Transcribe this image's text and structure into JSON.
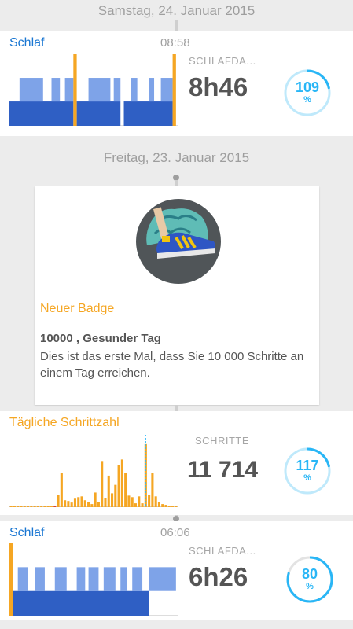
{
  "day1": {
    "date": "Samstag, 24. Januar 2015",
    "sleep": {
      "title": "Schlaf",
      "time": "08:58",
      "label": "SCHLAFDA...",
      "value": "8h46",
      "percent": "109",
      "percent_unit": "%",
      "percent_value": 109
    }
  },
  "day2": {
    "date": "Freitag, 23. Januar 2015",
    "badge": {
      "title": "Neuer Badge",
      "name": "10000 , Gesunder Tag",
      "description": "Dies ist das erste Mal, dass Sie 10 000 Schritte an einem Tag erreichen."
    },
    "steps": {
      "title": "Tägliche Schrittzahl",
      "label": "SCHRITTE",
      "value": "11 714",
      "percent": "117",
      "percent_unit": "%",
      "percent_value": 117
    },
    "sleep": {
      "title": "Schlaf",
      "time": "06:06",
      "label": "SCHLAFDA...",
      "value": "6h26",
      "percent": "80",
      "percent_unit": "%",
      "percent_value": 80
    }
  },
  "colors": {
    "sleep_title": "#1976d2",
    "steps_title": "#f5a623",
    "light_sleep": "#7ea3e8",
    "deep_sleep": "#2f5fc4",
    "awake": "#f5a623",
    "ring": "#29b6f6",
    "ring_track": "#e3e3e3"
  },
  "chart_data": [
    {
      "type": "bar",
      "title": "Schlaf",
      "note_segments": "sleep phase timeline, bands: light, deep, awake",
      "series": [
        {
          "phase": "deep",
          "spans": [
            [
              0,
              0.38
            ],
            [
              0.4,
              0.66
            ],
            [
              0.68,
              0.97
            ]
          ]
        },
        {
          "phase": "light",
          "spans": [
            [
              0.06,
              0.2
            ],
            [
              0.25,
              0.3
            ],
            [
              0.33,
              0.38
            ],
            [
              0.47,
              0.6
            ],
            [
              0.62,
              0.66
            ],
            [
              0.72,
              0.76
            ],
            [
              0.83,
              0.86
            ],
            [
              0.9,
              0.97
            ]
          ]
        },
        {
          "phase": "awake",
          "spans": [
            [
              0.38,
              0.4
            ],
            [
              0.97,
              0.99
            ]
          ]
        }
      ]
    },
    {
      "type": "bar",
      "title": "Tägliche Schrittzahl",
      "values": [
        2,
        2,
        2,
        2,
        2,
        2,
        2,
        2,
        2,
        2,
        2,
        2,
        2,
        2,
        16,
        45,
        9,
        8,
        6,
        11,
        13,
        14,
        9,
        7,
        4,
        19,
        7,
        60,
        12,
        41,
        18,
        29,
        55,
        62,
        45,
        15,
        13,
        5,
        14,
        5,
        82,
        16,
        45,
        14,
        7,
        4,
        3,
        2,
        2,
        2
      ]
    },
    {
      "type": "bar",
      "title": "Schlaf",
      "series": [
        {
          "phase": "deep",
          "spans": [
            [
              0.02,
              0.83
            ]
          ]
        },
        {
          "phase": "light",
          "spans": [
            [
              0.05,
              0.11
            ],
            [
              0.15,
              0.21
            ],
            [
              0.27,
              0.34
            ],
            [
              0.4,
              0.45
            ],
            [
              0.47,
              0.53
            ],
            [
              0.56,
              0.63
            ],
            [
              0.66,
              0.7
            ],
            [
              0.73,
              0.79
            ],
            [
              0.83,
              0.99
            ]
          ]
        },
        {
          "phase": "awake",
          "spans": [
            [
              0,
              0.02
            ]
          ]
        }
      ]
    }
  ]
}
